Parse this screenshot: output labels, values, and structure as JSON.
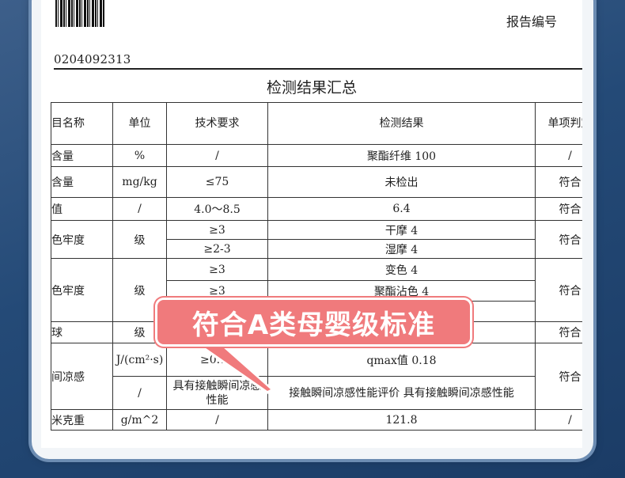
{
  "header": {
    "report_no_label": "报告编号",
    "report_no": "0204092313",
    "title": "检测结果汇总"
  },
  "table": {
    "headers": [
      "目名称",
      "单位",
      "技术要求",
      "检测结果",
      "单项判定"
    ],
    "rows": {
      "r1": {
        "item": "含量",
        "unit": "%",
        "req": "/",
        "result": "聚酯纤维 100",
        "verdict": "/"
      },
      "r2": {
        "item": "含量",
        "unit": "mg/kg",
        "req": "≤75",
        "result": "未检出",
        "verdict": "符合"
      },
      "r3": {
        "item": "值",
        "unit": "/",
        "req": "4.0～8.5",
        "result": "6.4",
        "verdict": "符合"
      },
      "r4": {
        "item": "色牢度",
        "unit": "级",
        "req_a": "≥3",
        "result_a": "干摩 4",
        "req_b": "≥2-3",
        "result_b": "湿摩 4",
        "verdict": "符合"
      },
      "r5": {
        "item": "色牢度",
        "unit": "级",
        "req_a": "≥3",
        "result_a": "变色 4",
        "req_b": "≥3",
        "result_b": "聚酯沾色 4",
        "verdict": "符合"
      },
      "r6": {
        "item": "球",
        "unit": "级",
        "verdict": "符合"
      },
      "r7": {
        "item": "间凉感",
        "unit_a": "J/(cm²·s)",
        "req_a": "≥0.15",
        "result_a": "qmax值 0.18",
        "unit_b": "/",
        "req_b": "具有接触瞬间凉感性能",
        "result_b": "接触瞬间凉感性能评价 具有接触瞬间凉感性能",
        "verdict": "符合"
      },
      "r8": {
        "item": "米克重",
        "unit": "g/m^2",
        "req": "/",
        "result": "121.8",
        "verdict": "/"
      }
    }
  },
  "badge": {
    "text": "符合A类母婴级标准"
  },
  "colors": {
    "badge": "#f07a7c",
    "frame": "#6c8cb2",
    "background": "#244a77"
  }
}
